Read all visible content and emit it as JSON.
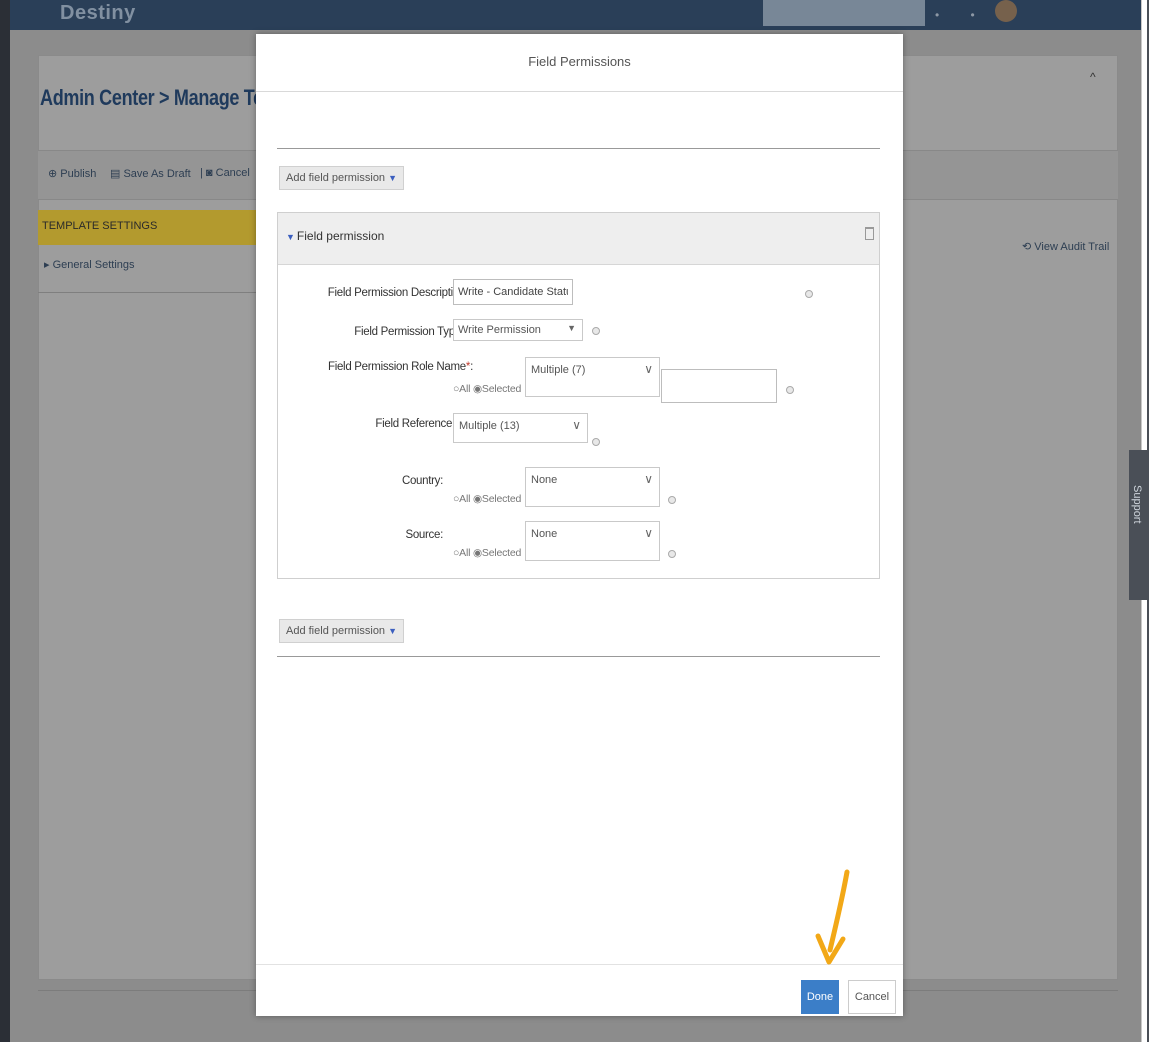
{
  "header": {
    "brand": "Destiny"
  },
  "background": {
    "title": "Admin Center > Manage Te",
    "toolbar": {
      "publish": "Publish",
      "save_draft": "Save As Draft",
      "cancel": "Cancel"
    },
    "template_settings": "TEMPLATE SETTINGS",
    "general_settings": "General Settings",
    "view_audit_trail": "View Audit Trail",
    "support": "Support"
  },
  "modal": {
    "title": "Field Permissions",
    "add_field_permission": "Add field permission",
    "panel_title": "Field permission",
    "fields": {
      "description_label": "Field Permission Description:",
      "description_value": "Write - Candidate Statu",
      "type_label": "Field Permission Type",
      "type_value": "Write Permission",
      "role_label": "Field Permission Role Name",
      "role_value": "Multiple (7)",
      "reference_label": "Field Reference ID",
      "reference_value": "Multiple (13)",
      "country_label": "Country:",
      "country_value": "None",
      "source_label": "Source:",
      "source_value": "None",
      "radio_all": "All",
      "radio_selected": "Selected",
      "required_marker": "*",
      "colon": ":"
    },
    "done": "Done",
    "cancel": "Cancel"
  },
  "colors": {
    "accent": "#3b7ec8",
    "annotation_arrow": "#f2a817",
    "template_bar": "#b39a2e"
  }
}
